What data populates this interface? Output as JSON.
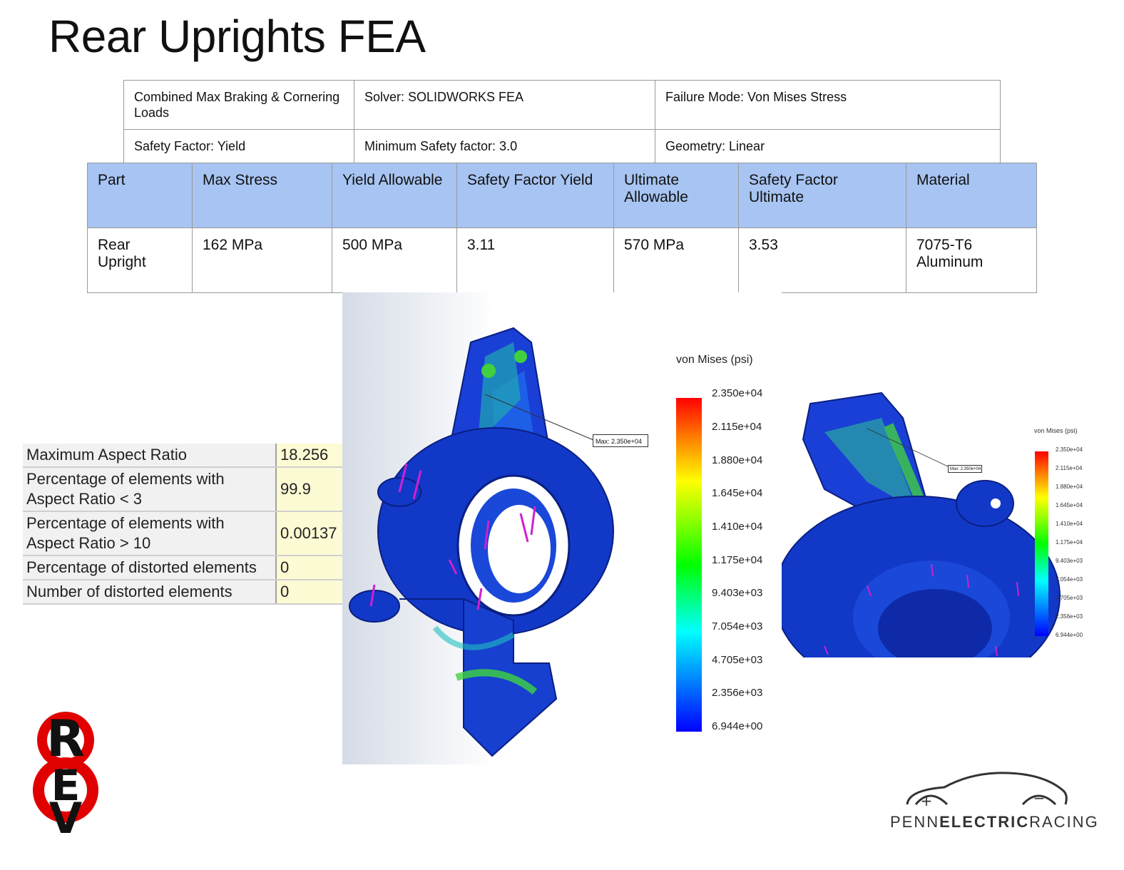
{
  "title": "Rear Uprights FEA",
  "conditions": {
    "load_case": "Combined Max Braking & Cornering Loads",
    "solver": "Solver: SOLIDWORKS FEA",
    "failure_mode": "Failure Mode: Von Mises Stress",
    "safety_factor": "Safety Factor: Yield",
    "min_safety_factor": "Minimum Safety factor: 3.0",
    "geometry": "Geometry: Linear"
  },
  "results": {
    "headers": [
      "Part",
      "Max Stress",
      "Yield Allowable",
      "Safety Factor Yield",
      "Ultimate Allowable",
      "Safety Factor Ultimate",
      "Material"
    ],
    "row": [
      "Rear Upright",
      "162 MPa",
      "500 MPa",
      "3.11",
      "570 MPa",
      "3.53",
      "7075-T6 Aluminum"
    ]
  },
  "mesh_quality": [
    {
      "label": "Maximum Aspect Ratio",
      "value": "18.256"
    },
    {
      "label": "Percentage of elements with Aspect Ratio < 3",
      "value": "99.9"
    },
    {
      "label": "Percentage of elements with Aspect Ratio > 10",
      "value": "0.00137"
    },
    {
      "label": "Percentage of distorted elements",
      "value": "0"
    },
    {
      "label": "Number of distorted elements",
      "value": "0"
    }
  ],
  "legend": {
    "title": "von Mises (psi)",
    "ticks": [
      "2.350e+04",
      "2.115e+04",
      "1.880e+04",
      "1.645e+04",
      "1.410e+04",
      "1.175e+04",
      "9.403e+03",
      "7.054e+03",
      "4.705e+03",
      "2.356e+03",
      "6.944e+00"
    ],
    "max_label": "Max:",
    "max_value": "2.350e+04",
    "colors": {
      "max": "#ff0000",
      "mid": "#00ff00",
      "min": "#0000ff"
    }
  },
  "legend_small": {
    "title": "von Mises (psi)",
    "ticks": [
      "2.350e+04",
      "2.115e+04",
      "1.880e+04",
      "1.645e+04",
      "1.410e+04",
      "1.175e+04",
      "9.403e+03",
      "7.054e+03",
      "4.705e+03",
      "2.356e+03",
      "6.944e+00"
    ],
    "max_tag": "Max: 2.350e+04"
  },
  "logos": {
    "rev": "REV",
    "team_prefix": "PENN",
    "team_bold": "ELECTRIC",
    "team_suffix": "RACING"
  },
  "header_color": "#a7c4f2"
}
